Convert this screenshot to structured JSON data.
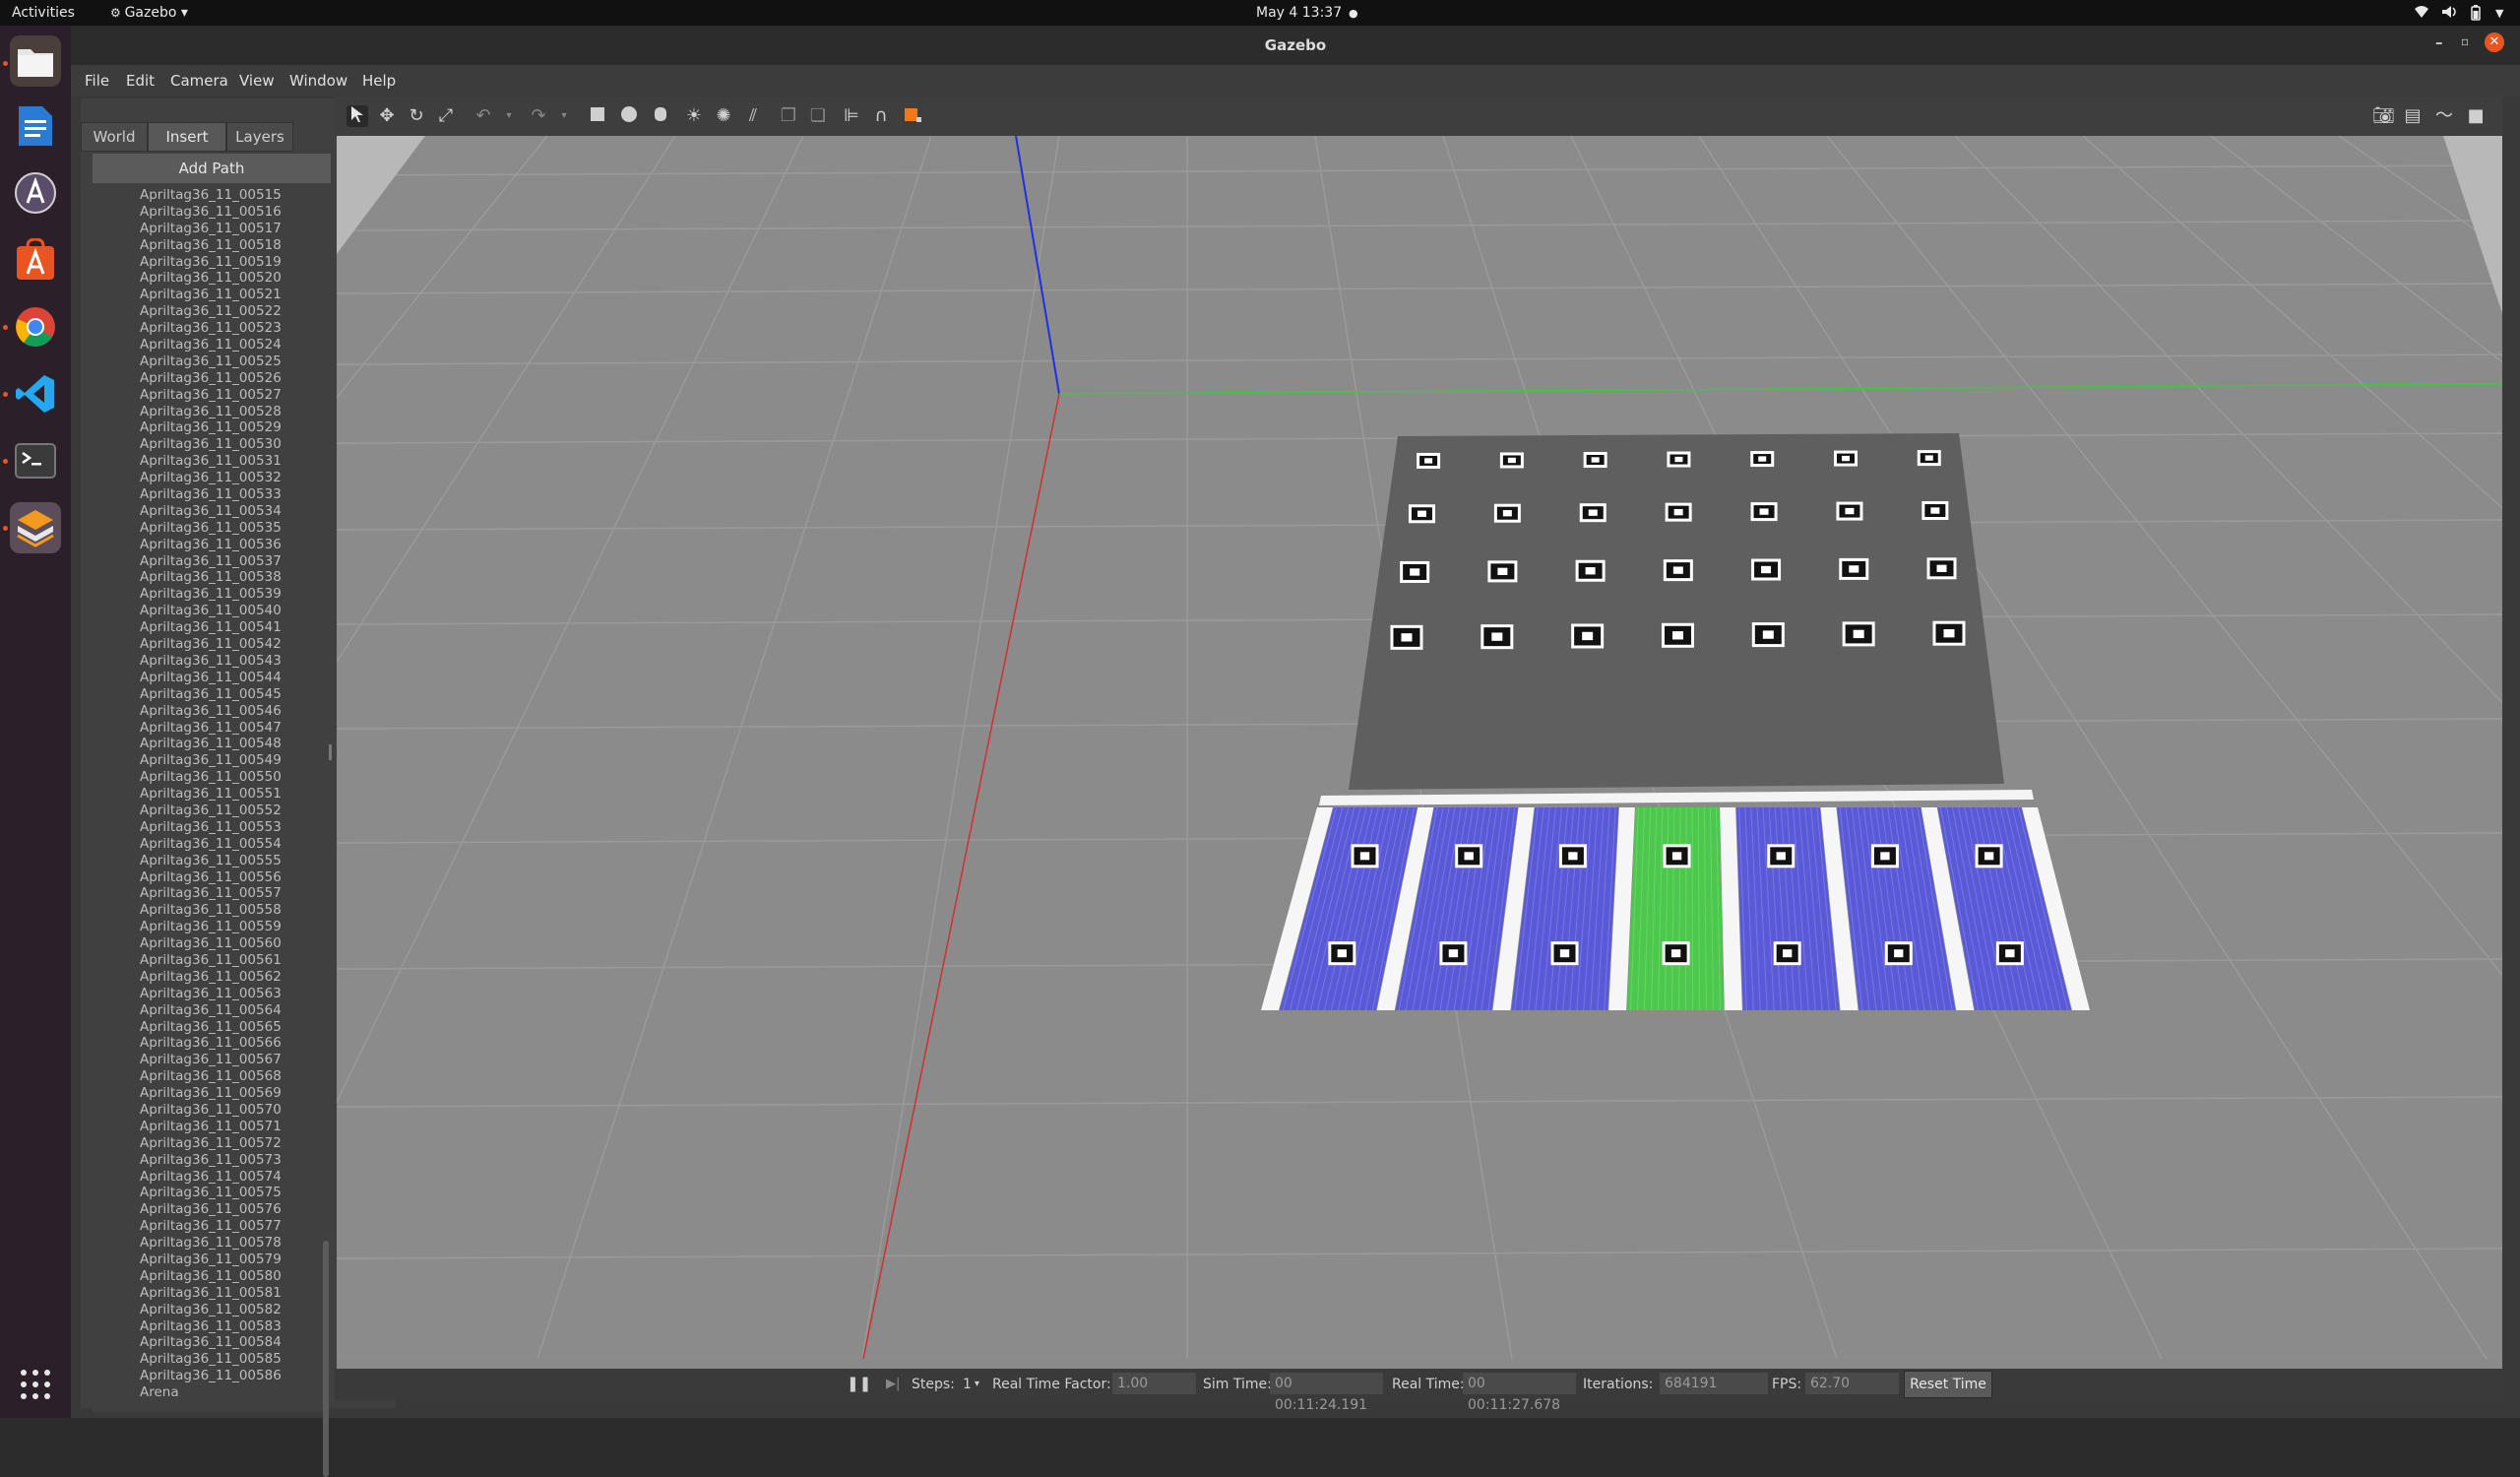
{
  "system_bar": {
    "activities": "Activities",
    "app_name": "Gazebo",
    "datetime": "May 4  13:37"
  },
  "window": {
    "title": "Gazebo"
  },
  "menu": [
    "File",
    "Edit",
    "Camera",
    "View",
    "Window",
    "Help"
  ],
  "left_panel": {
    "tabs": [
      "World",
      "Insert",
      "Layers"
    ],
    "active_tab": "Insert",
    "add_path_label": "Add Path",
    "models": [
      "Apriltag36_11_00515",
      "Apriltag36_11_00516",
      "Apriltag36_11_00517",
      "Apriltag36_11_00518",
      "Apriltag36_11_00519",
      "Apriltag36_11_00520",
      "Apriltag36_11_00521",
      "Apriltag36_11_00522",
      "Apriltag36_11_00523",
      "Apriltag36_11_00524",
      "Apriltag36_11_00525",
      "Apriltag36_11_00526",
      "Apriltag36_11_00527",
      "Apriltag36_11_00528",
      "Apriltag36_11_00529",
      "Apriltag36_11_00530",
      "Apriltag36_11_00531",
      "Apriltag36_11_00532",
      "Apriltag36_11_00533",
      "Apriltag36_11_00534",
      "Apriltag36_11_00535",
      "Apriltag36_11_00536",
      "Apriltag36_11_00537",
      "Apriltag36_11_00538",
      "Apriltag36_11_00539",
      "Apriltag36_11_00540",
      "Apriltag36_11_00541",
      "Apriltag36_11_00542",
      "Apriltag36_11_00543",
      "Apriltag36_11_00544",
      "Apriltag36_11_00545",
      "Apriltag36_11_00546",
      "Apriltag36_11_00547",
      "Apriltag36_11_00548",
      "Apriltag36_11_00549",
      "Apriltag36_11_00550",
      "Apriltag36_11_00551",
      "Apriltag36_11_00552",
      "Apriltag36_11_00553",
      "Apriltag36_11_00554",
      "Apriltag36_11_00555",
      "Apriltag36_11_00556",
      "Apriltag36_11_00557",
      "Apriltag36_11_00558",
      "Apriltag36_11_00559",
      "Apriltag36_11_00560",
      "Apriltag36_11_00561",
      "Apriltag36_11_00562",
      "Apriltag36_11_00563",
      "Apriltag36_11_00564",
      "Apriltag36_11_00565",
      "Apriltag36_11_00566",
      "Apriltag36_11_00567",
      "Apriltag36_11_00568",
      "Apriltag36_11_00569",
      "Apriltag36_11_00570",
      "Apriltag36_11_00571",
      "Apriltag36_11_00572",
      "Apriltag36_11_00573",
      "Apriltag36_11_00574",
      "Apriltag36_11_00575",
      "Apriltag36_11_00576",
      "Apriltag36_11_00577",
      "Apriltag36_11_00578",
      "Apriltag36_11_00579",
      "Apriltag36_11_00580",
      "Apriltag36_11_00581",
      "Apriltag36_11_00582",
      "Apriltag36_11_00583",
      "Apriltag36_11_00584",
      "Apriltag36_11_00585",
      "Apriltag36_11_00586",
      "Arena"
    ]
  },
  "toolbar_icons": [
    "select-arrow-icon",
    "translate-icon",
    "rotate-icon",
    "scale-icon",
    "undo-icon",
    "undo-dropdown-icon",
    "redo-icon",
    "redo-dropdown-icon",
    "box-icon",
    "sphere-icon",
    "cylinder-icon",
    "point-light-icon",
    "spot-light-icon",
    "directional-light-icon",
    "copy-icon",
    "paste-icon",
    "align-icon",
    "snap-icon",
    "change-view-icon",
    "screenshot-icon",
    "log-icon",
    "plot-icon",
    "record-video-icon"
  ],
  "bottom_bar": {
    "steps_label": "Steps:",
    "steps_value": "1",
    "rtf_label": "Real Time Factor:",
    "rtf_value": "1.00",
    "sim_time_label": "Sim Time:",
    "sim_time_value": "00 00:11:24.191",
    "real_time_label": "Real Time:",
    "real_time_value": "00 00:11:27.678",
    "iterations_label": "Iterations:",
    "iterations_value": "684191",
    "fps_label": "FPS:",
    "fps_value": "62.70",
    "reset_label": "Reset Time"
  },
  "scene": {
    "lane_colors": [
      "#5a5ad8",
      "#5a5ad8",
      "#5a5ad8",
      "#4cc84c",
      "#5a5ad8",
      "#5a5ad8",
      "#5a5ad8"
    ],
    "board_color": "#5f5f5f",
    "ground_color": "#8a8a8a"
  }
}
